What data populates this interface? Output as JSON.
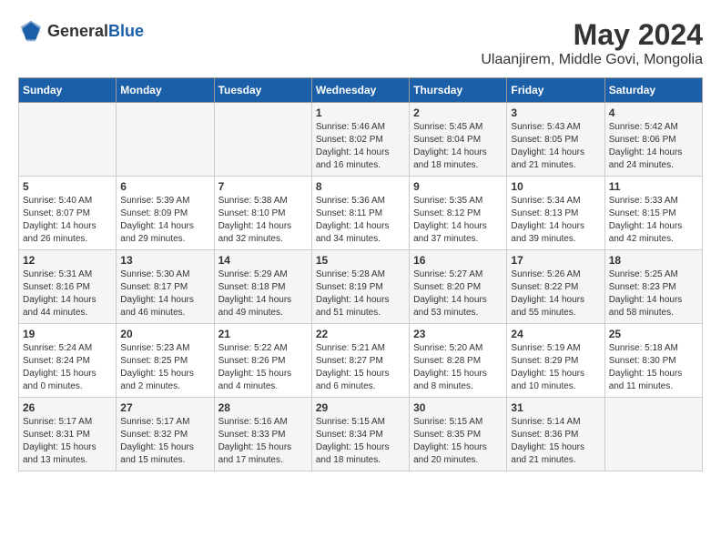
{
  "header": {
    "logo_general": "General",
    "logo_blue": "Blue",
    "month_year": "May 2024",
    "location": "Ulaanjirem, Middle Govi, Mongolia"
  },
  "days_of_week": [
    "Sunday",
    "Monday",
    "Tuesday",
    "Wednesday",
    "Thursday",
    "Friday",
    "Saturday"
  ],
  "weeks": [
    [
      {
        "day": "",
        "info": ""
      },
      {
        "day": "",
        "info": ""
      },
      {
        "day": "",
        "info": ""
      },
      {
        "day": "1",
        "info": "Sunrise: 5:46 AM\nSunset: 8:02 PM\nDaylight: 14 hours\nand 16 minutes."
      },
      {
        "day": "2",
        "info": "Sunrise: 5:45 AM\nSunset: 8:04 PM\nDaylight: 14 hours\nand 18 minutes."
      },
      {
        "day": "3",
        "info": "Sunrise: 5:43 AM\nSunset: 8:05 PM\nDaylight: 14 hours\nand 21 minutes."
      },
      {
        "day": "4",
        "info": "Sunrise: 5:42 AM\nSunset: 8:06 PM\nDaylight: 14 hours\nand 24 minutes."
      }
    ],
    [
      {
        "day": "5",
        "info": "Sunrise: 5:40 AM\nSunset: 8:07 PM\nDaylight: 14 hours\nand 26 minutes."
      },
      {
        "day": "6",
        "info": "Sunrise: 5:39 AM\nSunset: 8:09 PM\nDaylight: 14 hours\nand 29 minutes."
      },
      {
        "day": "7",
        "info": "Sunrise: 5:38 AM\nSunset: 8:10 PM\nDaylight: 14 hours\nand 32 minutes."
      },
      {
        "day": "8",
        "info": "Sunrise: 5:36 AM\nSunset: 8:11 PM\nDaylight: 14 hours\nand 34 minutes."
      },
      {
        "day": "9",
        "info": "Sunrise: 5:35 AM\nSunset: 8:12 PM\nDaylight: 14 hours\nand 37 minutes."
      },
      {
        "day": "10",
        "info": "Sunrise: 5:34 AM\nSunset: 8:13 PM\nDaylight: 14 hours\nand 39 minutes."
      },
      {
        "day": "11",
        "info": "Sunrise: 5:33 AM\nSunset: 8:15 PM\nDaylight: 14 hours\nand 42 minutes."
      }
    ],
    [
      {
        "day": "12",
        "info": "Sunrise: 5:31 AM\nSunset: 8:16 PM\nDaylight: 14 hours\nand 44 minutes."
      },
      {
        "day": "13",
        "info": "Sunrise: 5:30 AM\nSunset: 8:17 PM\nDaylight: 14 hours\nand 46 minutes."
      },
      {
        "day": "14",
        "info": "Sunrise: 5:29 AM\nSunset: 8:18 PM\nDaylight: 14 hours\nand 49 minutes."
      },
      {
        "day": "15",
        "info": "Sunrise: 5:28 AM\nSunset: 8:19 PM\nDaylight: 14 hours\nand 51 minutes."
      },
      {
        "day": "16",
        "info": "Sunrise: 5:27 AM\nSunset: 8:20 PM\nDaylight: 14 hours\nand 53 minutes."
      },
      {
        "day": "17",
        "info": "Sunrise: 5:26 AM\nSunset: 8:22 PM\nDaylight: 14 hours\nand 55 minutes."
      },
      {
        "day": "18",
        "info": "Sunrise: 5:25 AM\nSunset: 8:23 PM\nDaylight: 14 hours\nand 58 minutes."
      }
    ],
    [
      {
        "day": "19",
        "info": "Sunrise: 5:24 AM\nSunset: 8:24 PM\nDaylight: 15 hours\nand 0 minutes."
      },
      {
        "day": "20",
        "info": "Sunrise: 5:23 AM\nSunset: 8:25 PM\nDaylight: 15 hours\nand 2 minutes."
      },
      {
        "day": "21",
        "info": "Sunrise: 5:22 AM\nSunset: 8:26 PM\nDaylight: 15 hours\nand 4 minutes."
      },
      {
        "day": "22",
        "info": "Sunrise: 5:21 AM\nSunset: 8:27 PM\nDaylight: 15 hours\nand 6 minutes."
      },
      {
        "day": "23",
        "info": "Sunrise: 5:20 AM\nSunset: 8:28 PM\nDaylight: 15 hours\nand 8 minutes."
      },
      {
        "day": "24",
        "info": "Sunrise: 5:19 AM\nSunset: 8:29 PM\nDaylight: 15 hours\nand 10 minutes."
      },
      {
        "day": "25",
        "info": "Sunrise: 5:18 AM\nSunset: 8:30 PM\nDaylight: 15 hours\nand 11 minutes."
      }
    ],
    [
      {
        "day": "26",
        "info": "Sunrise: 5:17 AM\nSunset: 8:31 PM\nDaylight: 15 hours\nand 13 minutes."
      },
      {
        "day": "27",
        "info": "Sunrise: 5:17 AM\nSunset: 8:32 PM\nDaylight: 15 hours\nand 15 minutes."
      },
      {
        "day": "28",
        "info": "Sunrise: 5:16 AM\nSunset: 8:33 PM\nDaylight: 15 hours\nand 17 minutes."
      },
      {
        "day": "29",
        "info": "Sunrise: 5:15 AM\nSunset: 8:34 PM\nDaylight: 15 hours\nand 18 minutes."
      },
      {
        "day": "30",
        "info": "Sunrise: 5:15 AM\nSunset: 8:35 PM\nDaylight: 15 hours\nand 20 minutes."
      },
      {
        "day": "31",
        "info": "Sunrise: 5:14 AM\nSunset: 8:36 PM\nDaylight: 15 hours\nand 21 minutes."
      },
      {
        "day": "",
        "info": ""
      }
    ]
  ]
}
